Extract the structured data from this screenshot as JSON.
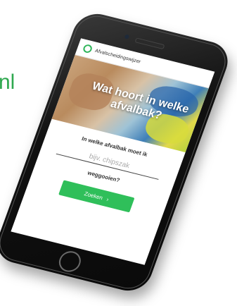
{
  "background": {
    "domain_suffix": "nl"
  },
  "app": {
    "title": "Afvalscheidingswijzer"
  },
  "hero": {
    "title": "Wat hoort in welke afvalbak?"
  },
  "form": {
    "question_part1": "In welke afvalbak moet ik",
    "placeholder": "bijv. chipszak",
    "question_part2": "weggooien?",
    "search_label": "Zoeken",
    "search_icon": "›"
  },
  "colors": {
    "accent": "#2fbf5a",
    "background_text": "#2fa84f"
  }
}
